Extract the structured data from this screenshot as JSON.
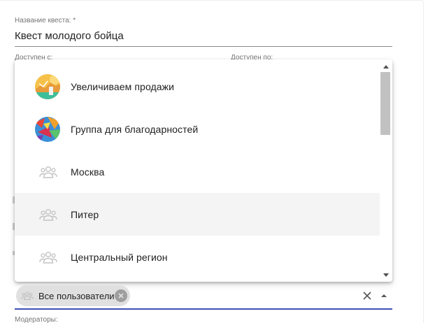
{
  "form": {
    "title_label": "Название квеста: *",
    "title_value": "Квест молодого бойца",
    "from_label": "Доступен с:",
    "to_label": "Доступен по:",
    "moderators_label": "Модераторы:"
  },
  "dropdown": {
    "items": [
      {
        "label": "Увеличиваем продажи",
        "icon": "avatar-sales"
      },
      {
        "label": "Группа для благодарностей",
        "icon": "avatar-thanks"
      },
      {
        "label": "Москва",
        "icon": "group-icon"
      },
      {
        "label": "Питер",
        "icon": "group-icon",
        "hovered": true
      },
      {
        "label": "Центральный регион",
        "icon": "group-icon"
      }
    ]
  },
  "users": {
    "chip_label": "Все пользователи",
    "chip_icon": "group-icon",
    "accent_color": "#3f51b5"
  }
}
